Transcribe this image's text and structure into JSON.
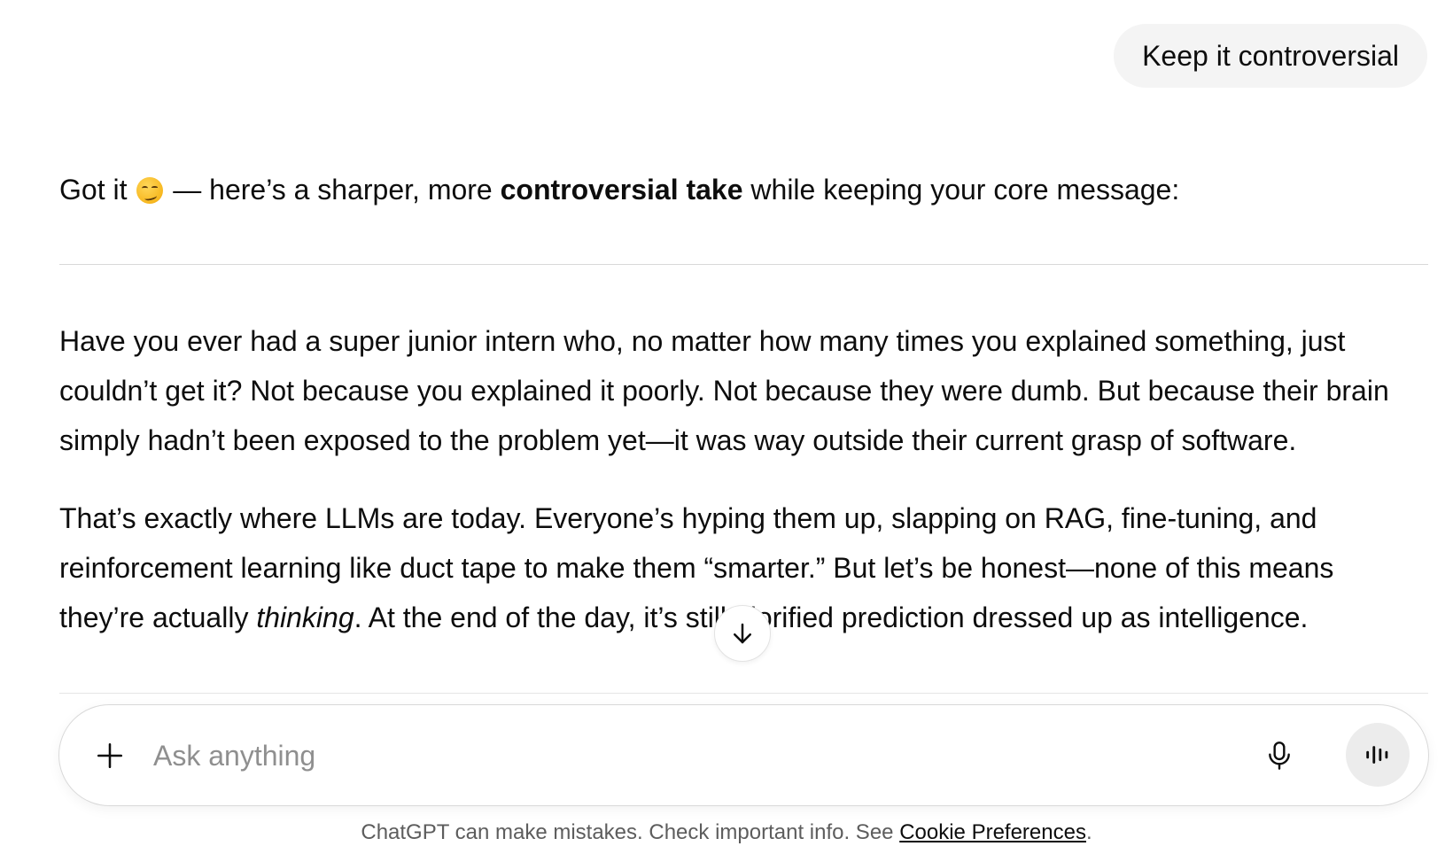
{
  "user_message": {
    "text": "Keep it controversial"
  },
  "assistant": {
    "intro": {
      "before_emoji": "Got it",
      "emoji_name": "smirking-face",
      "after_emoji": " — here’s a sharper, more ",
      "bold": "controversial take",
      "after_bold": " while keeping your core message:"
    },
    "paragraph1": {
      "lines": [
        "Have you ever had a super junior intern who, no matter how many times you explained something, just",
        "couldn’t get it? Not because you explained it poorly. Not because they were dumb. But because their brain",
        "simply hadn’t been exposed to the problem yet—it was way outside their current grasp of software."
      ]
    },
    "paragraph2": {
      "line1": "That’s exactly where LLMs are today. Everyone’s hyping them up, slapping on RAG, fine-tuning, and",
      "line2": "reinforcement learning like duct tape to make them “smarter.” But let’s be honest—none of this means",
      "line3_before_italic": "they’re actually ",
      "line3_italic": "thinking",
      "line3_after_italic": ". At the end of the day, it’s still glorified prediction dressed up as intelligence."
    }
  },
  "scroll_button": {
    "icon": "arrow-down-icon"
  },
  "composer": {
    "placeholder": "Ask anything",
    "value": "",
    "plus_icon": "plus-icon",
    "mic_icon": "microphone-icon",
    "voice_icon": "voice-waveform-icon"
  },
  "footer": {
    "text": "ChatGPT can make mistakes. Check important info. See ",
    "link": "Cookie Preferences",
    "after_link": "."
  }
}
